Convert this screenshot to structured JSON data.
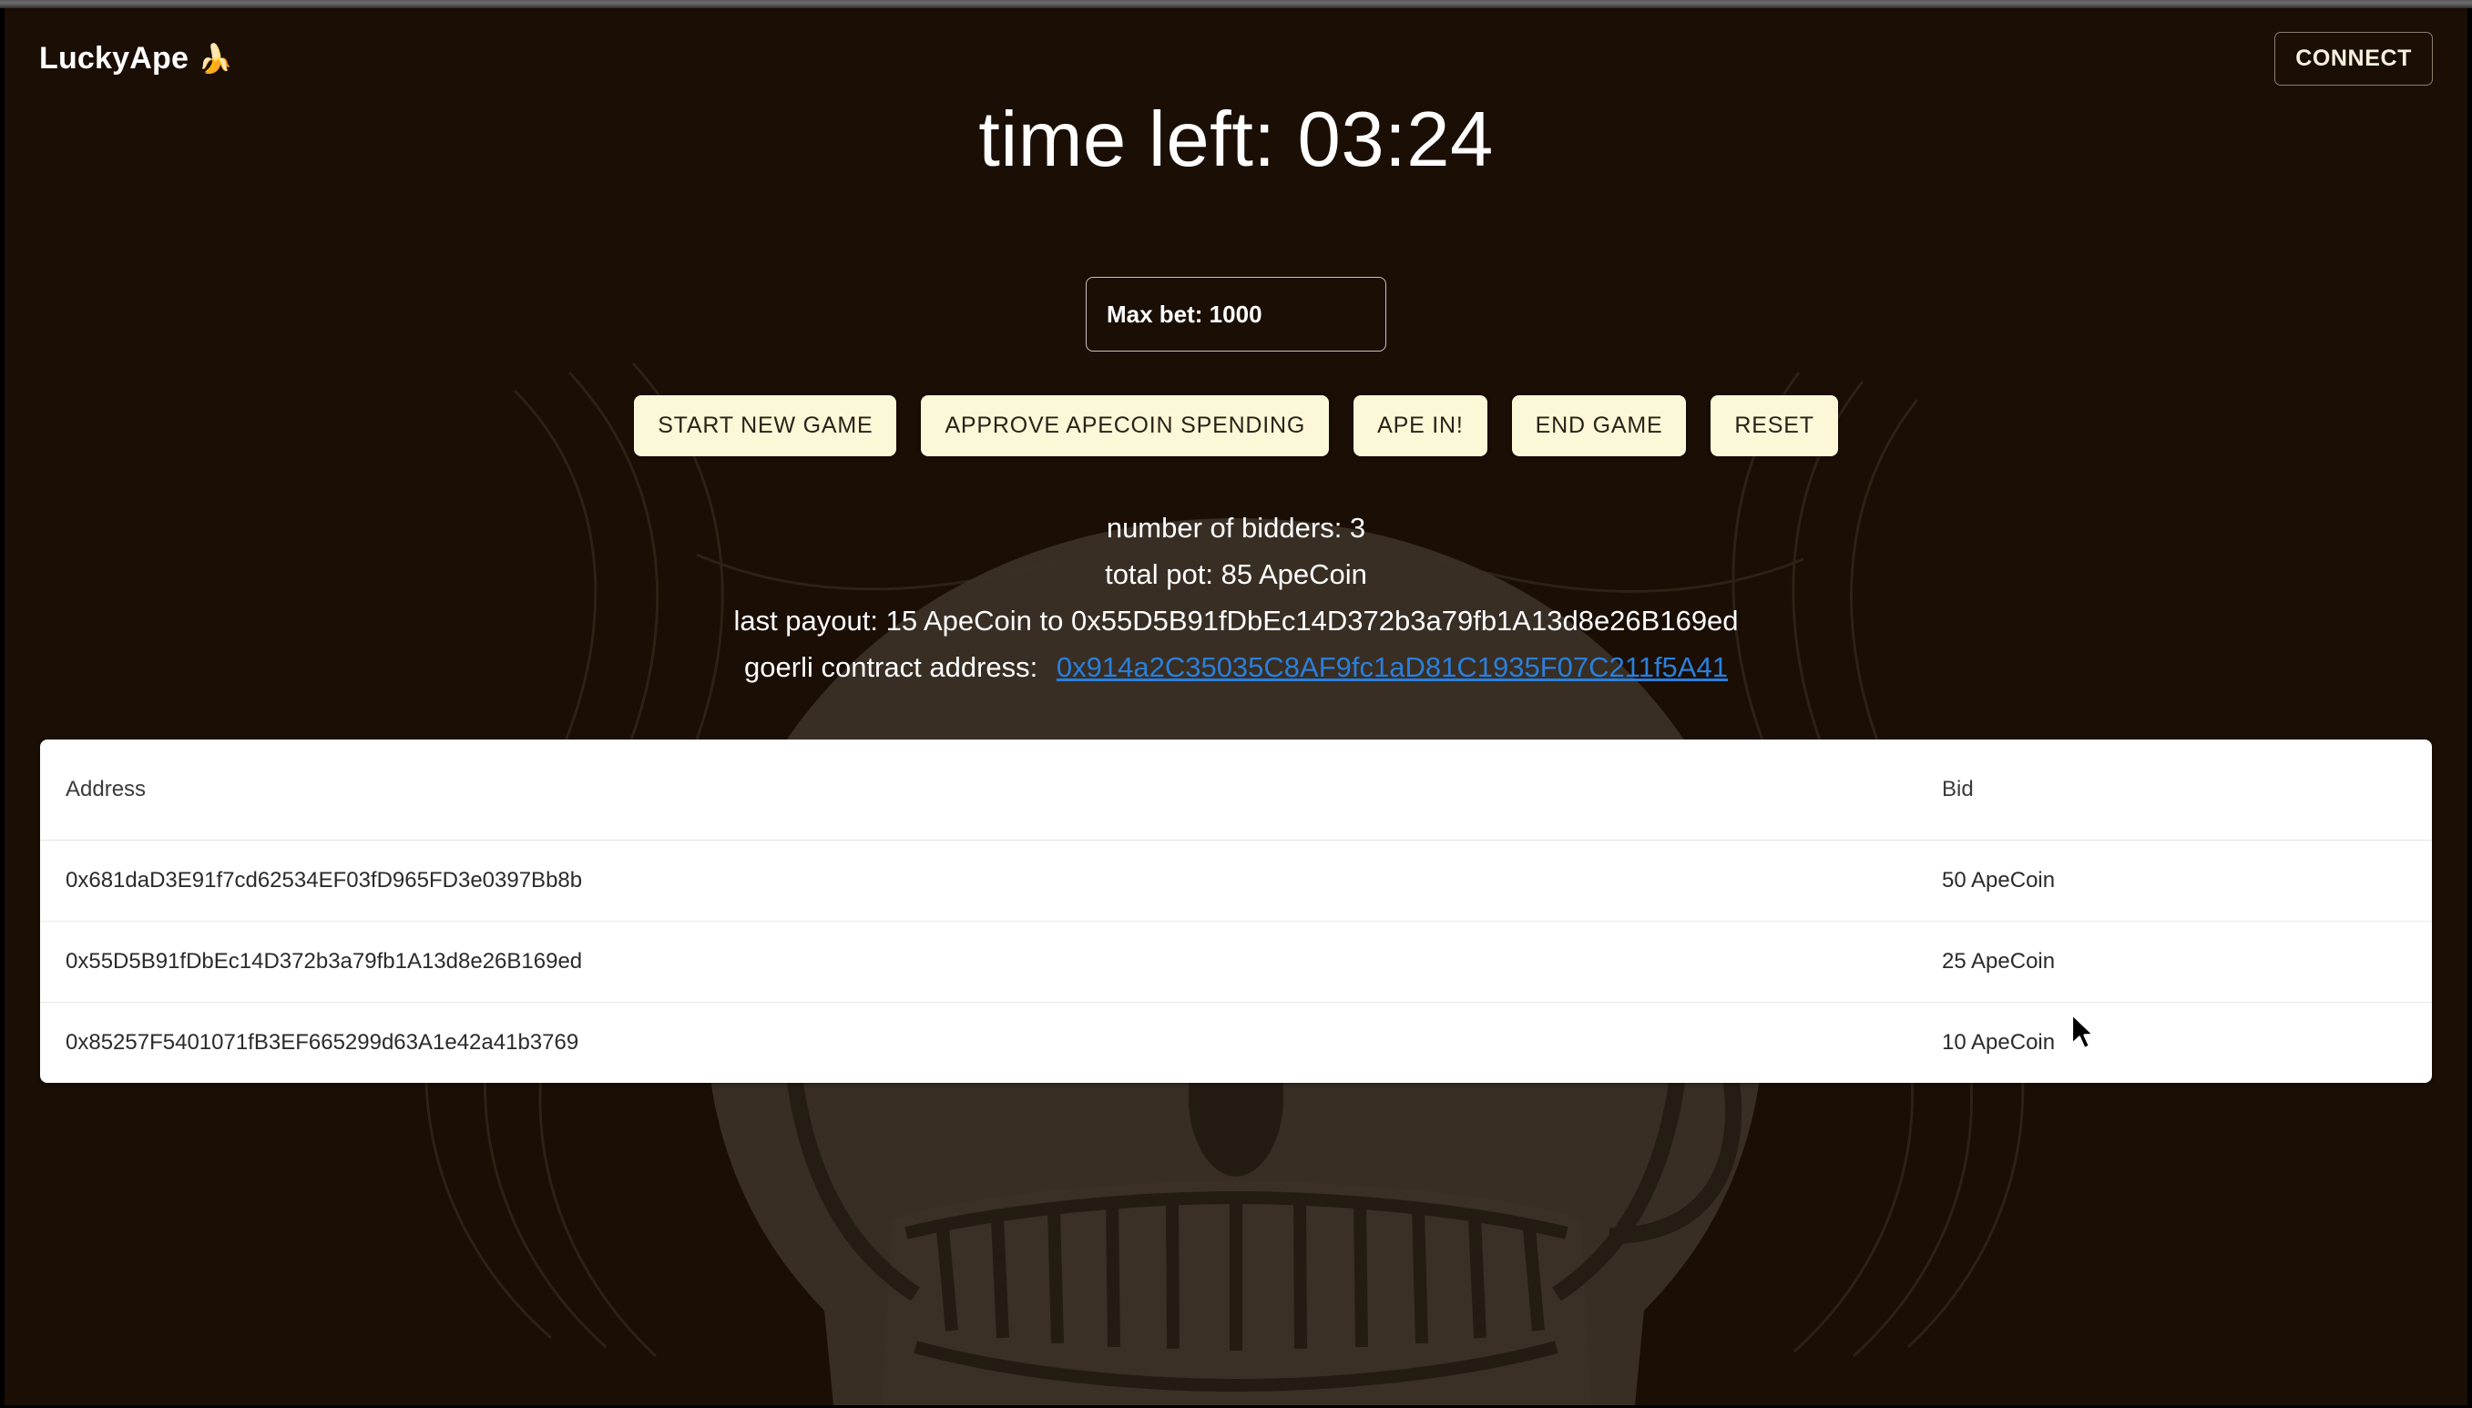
{
  "header": {
    "brand_name": "LuckyApe",
    "brand_emoji": "🍌",
    "connect_label": "CONNECT"
  },
  "timer": {
    "label": "time left: 03:24"
  },
  "max_bet": {
    "value": "Max bet: 1000",
    "placeholder": "Max bet: 1000"
  },
  "actions": {
    "buttons": [
      {
        "label": "START NEW GAME",
        "name": "start-new-game-button"
      },
      {
        "label": "APPROVE APECOIN SPENDING",
        "name": "approve-apecoin-spending-button"
      },
      {
        "label": "APE IN!",
        "name": "ape-in-button"
      },
      {
        "label": "END GAME",
        "name": "end-game-button"
      },
      {
        "label": "RESET",
        "name": "reset-button"
      }
    ]
  },
  "stats": {
    "number_of_bidders": "number of bidders: 3",
    "total_pot": "total pot: 85 ApeCoin",
    "last_payout": "last payout: 15 ApeCoin to 0x55D5B91fDbEc14D372b3a79fb1A13d8e26B169ed",
    "contract_label": "goerli contract address:",
    "contract_address": "0x914a2C35035C8AF9fc1aD81C1935F07C211f5A41"
  },
  "table": {
    "columns": [
      "Address",
      "Bid"
    ],
    "rows": [
      {
        "address": "0x681daD3E91f7cd62534EF03fD965FD3e0397Bb8b",
        "bid": "50 ApeCoin"
      },
      {
        "address": "0x55D5B91fDbEc14D372b3a79fb1A13d8e26B169ed",
        "bid": "25 ApeCoin"
      },
      {
        "address": "0x85257F5401071fB3EF665299d63A1e42a41b3769",
        "bid": "10 ApeCoin"
      }
    ]
  },
  "colors": {
    "background": "#1a0e05",
    "button_face": "#fbf8d8",
    "button_text": "#2a2218",
    "link": "#2a7fdc",
    "text": "#ffffff",
    "table_background": "#ffffff"
  }
}
